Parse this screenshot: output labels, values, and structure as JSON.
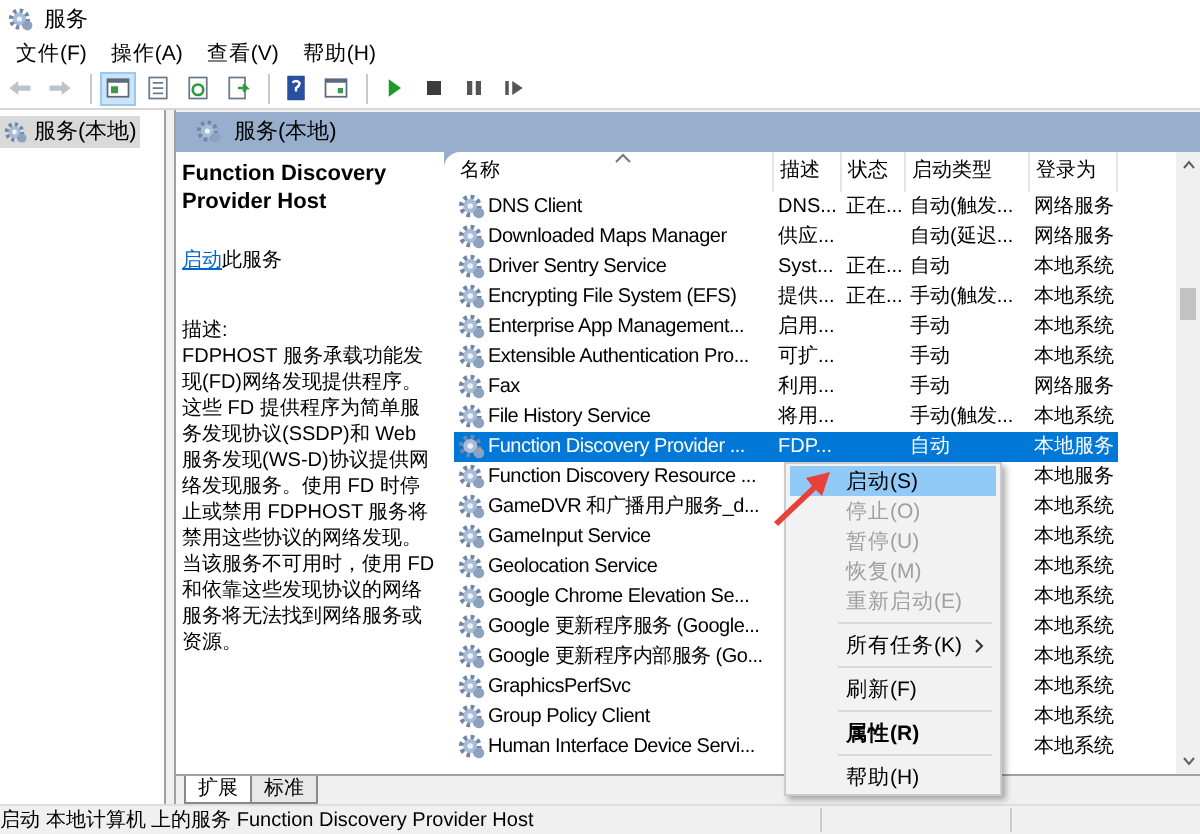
{
  "window": {
    "title": "服务"
  },
  "menu_bar": [
    {
      "label": "文件(F)"
    },
    {
      "label": "操作(A)"
    },
    {
      "label": "查看(V)"
    },
    {
      "label": "帮助(H)"
    }
  ],
  "toolbar": [
    {
      "kind": "back",
      "disabled": true,
      "pressed": false
    },
    {
      "kind": "forward",
      "disabled": true,
      "pressed": false
    },
    {
      "kind": "separator"
    },
    {
      "kind": "tree",
      "disabled": false,
      "pressed": true
    },
    {
      "kind": "list",
      "disabled": false,
      "pressed": false
    },
    {
      "kind": "refresh",
      "disabled": false,
      "pressed": false
    },
    {
      "kind": "export",
      "disabled": false,
      "pressed": false
    },
    {
      "kind": "separator"
    },
    {
      "kind": "help",
      "disabled": false,
      "pressed": false
    },
    {
      "kind": "window",
      "disabled": false,
      "pressed": false
    },
    {
      "kind": "separator"
    },
    {
      "kind": "play",
      "disabled": false,
      "pressed": false
    },
    {
      "kind": "stop",
      "disabled": false,
      "pressed": false
    },
    {
      "kind": "pause",
      "disabled": false,
      "pressed": false
    },
    {
      "kind": "resume",
      "disabled": false,
      "pressed": false
    }
  ],
  "tree": {
    "items": [
      {
        "label": "服务(本地)",
        "selected": true
      }
    ]
  },
  "pane_header": {
    "title": "服务(本地)"
  },
  "details": {
    "service_name": "Function Discovery Provider Host",
    "action_link": "启动",
    "action_suffix": "此服务",
    "description_label": "描述:",
    "description": "FDPHOST 服务承载功能发现(FD)网络发现提供程序。这些 FD 提供程序为简单服务发现协议(SSDP)和 Web 服务发现(WS-D)协议提供网络发现服务。使用 FD 时停止或禁用 FDPHOST 服务将禁用这些协议的网络发现。当该服务不可用时，使用 FD 和依靠这些发现协议的网络服务将无法找到网络服务或资源。"
  },
  "services": {
    "columns": [
      {
        "label": "名称",
        "sorted": true
      },
      {
        "label": "描述",
        "sorted": false
      },
      {
        "label": "状态",
        "sorted": false
      },
      {
        "label": "启动类型",
        "sorted": false
      },
      {
        "label": "登录为",
        "sorted": false
      }
    ],
    "rows": [
      {
        "name": "DNS Client",
        "description": "DNS...",
        "status": "正在...",
        "startup_type": "自动(触发...",
        "logon_as": "网络服务",
        "selected": false
      },
      {
        "name": "Downloaded Maps Manager",
        "description": "供应...",
        "startup_type": "自动(延迟...",
        "logon_as": "网络服务",
        "selected": false
      },
      {
        "name": "Driver Sentry Service",
        "description": "Syst...",
        "status": "正在...",
        "startup_type": "自动",
        "logon_as": "本地系统",
        "selected": false
      },
      {
        "name": "Encrypting File System (EFS)",
        "description": "提供...",
        "status": "正在...",
        "startup_type": "手动(触发...",
        "logon_as": "本地系统",
        "selected": false
      },
      {
        "name": "Enterprise App Management...",
        "description": "启用...",
        "startup_type": "手动",
        "logon_as": "本地系统",
        "selected": false
      },
      {
        "name": "Extensible Authentication Pro...",
        "description": "可扩...",
        "startup_type": "手动",
        "logon_as": "本地系统",
        "selected": false
      },
      {
        "name": "Fax",
        "description": "利用...",
        "startup_type": "手动",
        "logon_as": "网络服务",
        "selected": false
      },
      {
        "name": "File History Service",
        "description": "将用...",
        "startup_type": "手动(触发...",
        "logon_as": "本地系统",
        "selected": false
      },
      {
        "name": "Function Discovery Provider ...",
        "description": "FDP...",
        "startup_type": "自动",
        "logon_as": "本地服务",
        "selected": true
      },
      {
        "name": "Function Discovery Resource ...",
        "logon_as": "本地服务",
        "selected": false
      },
      {
        "name": "GameDVR 和广播用户服务_d...",
        "logon_as": "本地系统",
        "selected": false
      },
      {
        "name": "GameInput Service",
        "logon_as": "本地系统",
        "selected": false
      },
      {
        "name": "Geolocation Service",
        "logon_as": "本地系统",
        "selected": false
      },
      {
        "name": "Google Chrome Elevation Se...",
        "logon_as": "本地系统",
        "selected": false
      },
      {
        "name": "Google 更新程序服务 (Google...",
        "logon_as": "本地系统",
        "selected": false
      },
      {
        "name": "Google 更新程序内部服务 (Go...",
        "logon_as": "本地系统",
        "selected": false
      },
      {
        "name": "GraphicsPerfSvc",
        "logon_as": "本地系统",
        "selected": false
      },
      {
        "name": "Group Policy Client",
        "logon_as": "本地系统",
        "selected": false
      },
      {
        "name": "Human Interface Device Servi...",
        "logon_as": "本地系统",
        "selected": false
      }
    ]
  },
  "context_menu": [
    {
      "kind": "item",
      "label": "启动(S)",
      "highlighted": true,
      "disabled": false,
      "default": false,
      "submenu": false
    },
    {
      "kind": "item",
      "label": "停止(O)",
      "highlighted": false,
      "disabled": true,
      "default": false,
      "submenu": false
    },
    {
      "kind": "item",
      "label": "暂停(U)",
      "highlighted": false,
      "disabled": true,
      "default": false,
      "submenu": false
    },
    {
      "kind": "item",
      "label": "恢复(M)",
      "highlighted": false,
      "disabled": true,
      "default": false,
      "submenu": false
    },
    {
      "kind": "item",
      "label": "重新启动(E)",
      "highlighted": false,
      "disabled": true,
      "default": false,
      "submenu": false
    },
    {
      "kind": "separator"
    },
    {
      "kind": "item",
      "label": "所有任务(K)",
      "highlighted": false,
      "disabled": false,
      "default": false,
      "submenu": true
    },
    {
      "kind": "separator"
    },
    {
      "kind": "item",
      "label": "刷新(F)",
      "highlighted": false,
      "disabled": false,
      "default": false,
      "submenu": false
    },
    {
      "kind": "separator"
    },
    {
      "kind": "item",
      "label": "属性(R)",
      "highlighted": false,
      "disabled": false,
      "default": true,
      "submenu": false
    },
    {
      "kind": "separator"
    },
    {
      "kind": "item",
      "label": "帮助(H)",
      "highlighted": false,
      "disabled": false,
      "default": false,
      "submenu": false
    }
  ],
  "bottom_tabs": [
    {
      "label": "扩展",
      "selected": true
    },
    {
      "label": "标准",
      "selected": false
    }
  ],
  "status_bar": {
    "text": "启动 本地计算机 上的服务 Function Discovery Provider Host"
  }
}
